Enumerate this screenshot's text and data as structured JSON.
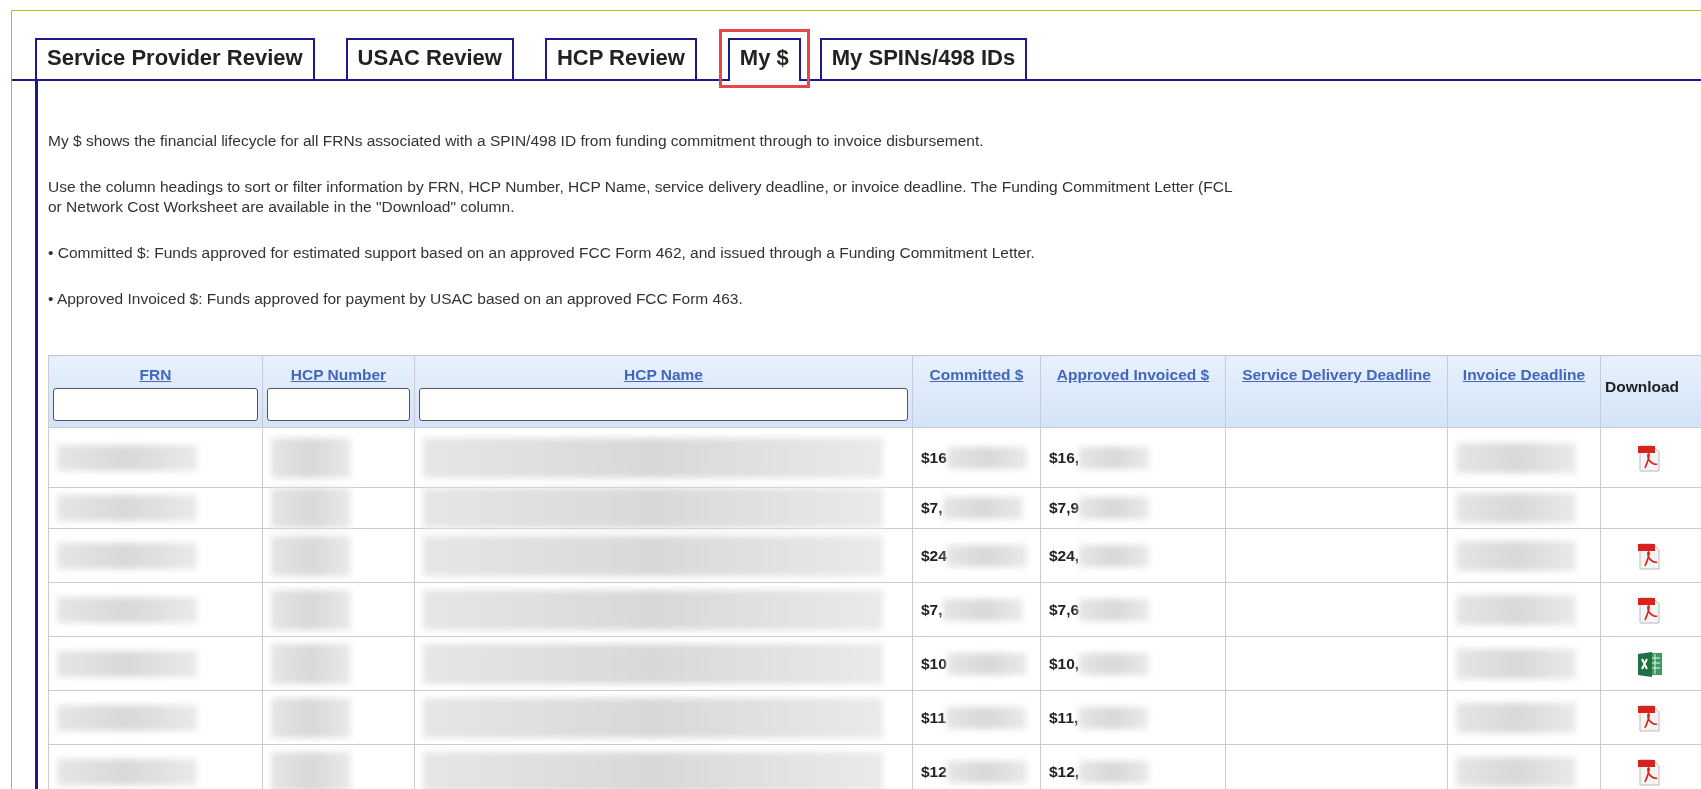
{
  "tabs": [
    {
      "label": "Service Provider Review",
      "selected": false,
      "highlighted": false
    },
    {
      "label": "USAC Review",
      "selected": false,
      "highlighted": false
    },
    {
      "label": "HCP Review",
      "selected": false,
      "highlighted": false
    },
    {
      "label": "My $",
      "selected": true,
      "highlighted": true
    },
    {
      "label": "My SPINs/498 IDs",
      "selected": false,
      "highlighted": false
    }
  ],
  "paragraphs": [
    "My $ shows the financial lifecycle for all FRNs associated with a SPIN/498 ID from funding commitment through to invoice disbursement.",
    "Use the column headings to sort or filter information by FRN, HCP Number, HCP Name, service delivery deadline, or invoice deadline. The Funding Commitment Letter (FCL",
    "or Network Cost Worksheet are available in the \"Download\" column.",
    "• Committed $: Funds approved for estimated support based on an approved FCC Form 462, and issued through a Funding Commitment Letter.",
    "• Approved Invoiced $: Funds approved for payment by USAC based on an approved FCC Form 463."
  ],
  "table": {
    "columns": [
      {
        "label": "FRN",
        "kind": "filter"
      },
      {
        "label": "HCP Number",
        "kind": "filter"
      },
      {
        "label": "HCP Name",
        "kind": "filter"
      },
      {
        "label": "Committed $",
        "kind": "sort"
      },
      {
        "label": "Approved Invoiced $",
        "kind": "sort"
      },
      {
        "label": "Service Delivery Deadline",
        "kind": "sort"
      },
      {
        "label": "Invoice Deadline",
        "kind": "sort"
      },
      {
        "label": "Download",
        "kind": "plain"
      }
    ],
    "rows": [
      {
        "committed": "$16",
        "approved": "$16,",
        "kind": "pdf",
        "redacted": true
      },
      {
        "committed": "$7,",
        "approved": "$7,9",
        "kind": "none",
        "redacted": true
      },
      {
        "committed": "$24",
        "approved": "$24,",
        "kind": "pdf",
        "redacted": true
      },
      {
        "committed": "$7,",
        "approved": "$7,6",
        "kind": "pdf",
        "redacted": true
      },
      {
        "committed": "$10",
        "approved": "$10,",
        "kind": "excel",
        "redacted": true
      },
      {
        "committed": "$11",
        "approved": "$11,",
        "kind": "pdf",
        "redacted": true
      },
      {
        "committed": "$12",
        "approved": "$12,",
        "kind": "pdf",
        "redacted": true
      }
    ]
  }
}
